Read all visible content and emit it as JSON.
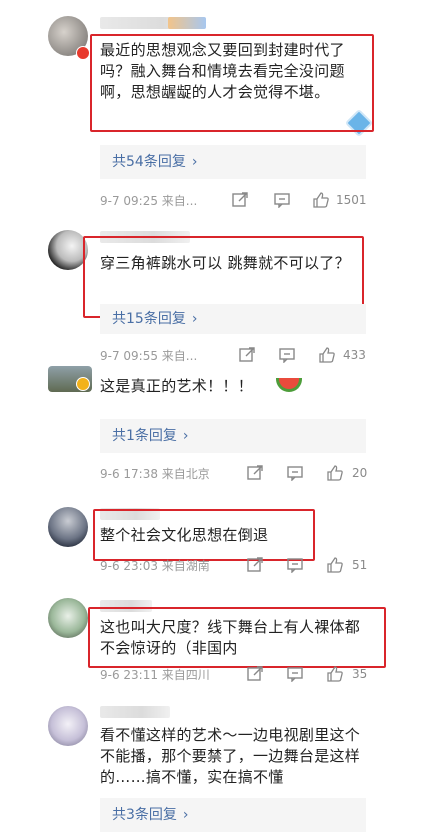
{
  "comments": [
    {
      "text": "最近的思想观念又要回到封建时代了吗？融入舞台和情境去看完全没问题啊，思想龌龊的人才会觉得不堪。",
      "replies": "共54条回复",
      "time": "9-7 09:25  来自...",
      "likes": "1501"
    },
    {
      "text": "穿三角裤跳水可以  跳舞就不可以了？",
      "replies": "共15条回复",
      "time": "9-7 09:55  来自...",
      "likes": "433"
    },
    {
      "text": "这是真正的艺术！！！",
      "replies": "共1条回复",
      "time": "9-6 17:38  来自北京",
      "likes": "20"
    },
    {
      "text": "整个社会文化思想在倒退",
      "time": "9-6 23:03  来自湖南",
      "likes": "51"
    },
    {
      "text": "这也叫大尺度？线下舞台上有人裸体都不会惊讶的（非国内",
      "time": "9-6 23:11  来自四川",
      "likes": "35"
    },
    {
      "text": "看不懂这样的艺术～一边电视剧里这个不能播，那个要禁了，一边舞台是这样的……搞不懂，实在搞不懂",
      "replies": "共3条回复"
    }
  ],
  "reply_chevron": "›",
  "colors": {
    "accent": "#d9252b",
    "link": "#4a6fa5",
    "meta": "#9a9a9a"
  },
  "icons": [
    "share-icon",
    "comment-icon",
    "like-icon"
  ]
}
